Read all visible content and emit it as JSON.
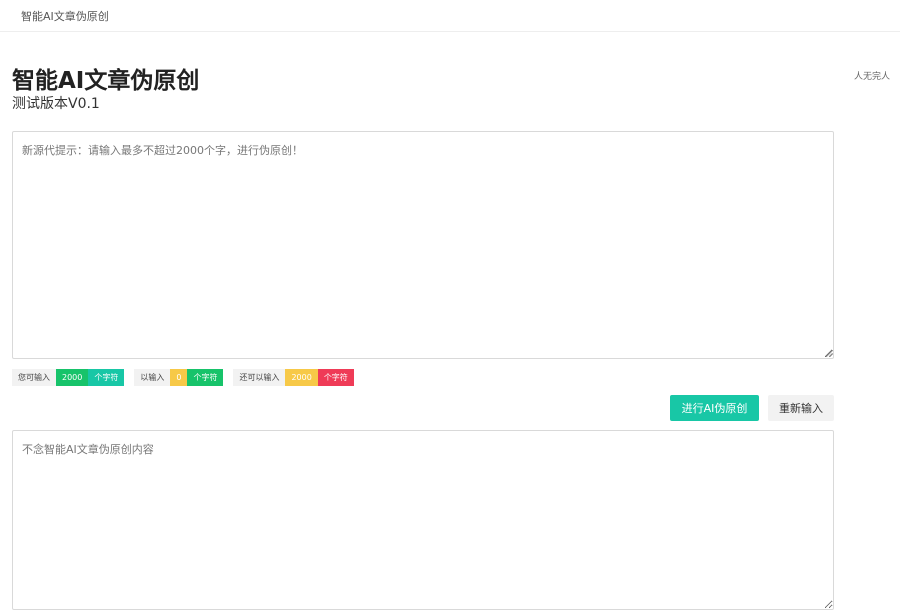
{
  "topbar": {
    "title": "智能AI文章伪原创"
  },
  "side_link": "人无完人",
  "header": {
    "title": "智能AI文章伪原创",
    "subtitle": "测试版本V0.1"
  },
  "input": {
    "placeholder": "新源代提示：请输入最多不超过2000个字，进行伪原创！",
    "value": ""
  },
  "stats": [
    {
      "label": "您可输入",
      "value": "2000",
      "unit": "个字符",
      "value_color": "#17c36a",
      "unit_color": "#18c7a6"
    },
    {
      "label": "以输入",
      "value": "0",
      "unit": "个字符",
      "value_color": "#f7c948",
      "unit_color": "#17c36a"
    },
    {
      "label": "还可以输入",
      "value": "2000",
      "unit": "个字符",
      "value_color": "#f7c948",
      "unit_color": "#ef3b57"
    }
  ],
  "buttons": {
    "rewrite": "进行AI伪原创",
    "reset": "重新输入"
  },
  "output": {
    "placeholder": "不念智能AI文章伪原创内容"
  },
  "colors": {
    "accent": "#18c7a6"
  }
}
